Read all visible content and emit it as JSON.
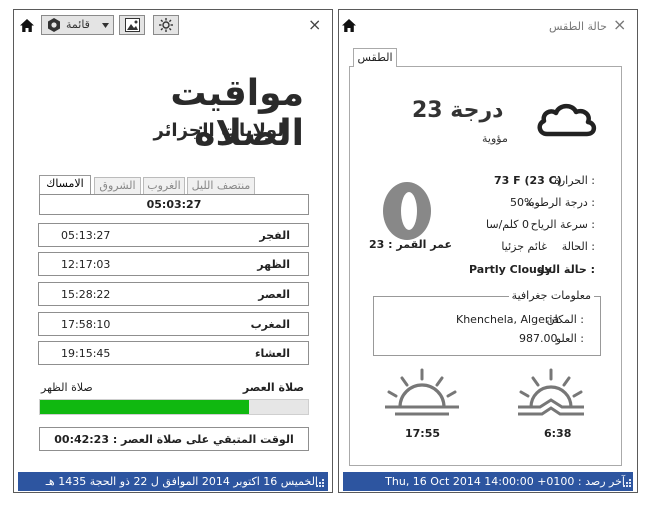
{
  "left_window": {
    "toolbar": {
      "menu_label": "قائمة",
      "home_icon": "home-icon",
      "settings_icon": "gear-icon",
      "image_icon": "image-icon",
      "brightness_icon": "sun-icon",
      "close_label": "×"
    },
    "logo_title": "مواقيت الصلاة",
    "logo_subtitle": "لولايات الجزائر",
    "tabs": [
      "الامساك",
      "الشروق",
      "الغروب",
      "منتصف الليل"
    ],
    "selected_time": "05:03:27",
    "prayers": [
      {
        "name": "الفجر",
        "time": "05:13:27"
      },
      {
        "name": "الظهر",
        "time": "12:17:03"
      },
      {
        "name": "العصر",
        "time": "15:28:22"
      },
      {
        "name": "المغرب",
        "time": "17:58:10"
      },
      {
        "name": "العشاء",
        "time": "19:15:45"
      }
    ],
    "progress": {
      "next_label": "صلاة العصر",
      "prev_label": "صلاة الظهر",
      "fraction": 0.78,
      "fill_color": "#10b810"
    },
    "remaining": "الوقت المتبقي على صلاة العصر : 00:42:23",
    "status_bar": "الخميس 16 اكتوبر 2014 الموافق ل 22 ذو الحجة 1435 هـ"
  },
  "right_window": {
    "title": "حالة الطقس",
    "close_label": "×",
    "tab_label": "الطقس",
    "temperature": "23 درجة",
    "unit_label": "مؤوية",
    "moon_age": "عمر القمر : 23",
    "details": [
      {
        "label": "الحرارة :",
        "value": "73 F (23 C)"
      },
      {
        "label": "درجة الرطوبة :",
        "value": "50%"
      },
      {
        "label": "سرعة الرياح :",
        "value": "0 كلم/سا"
      },
      {
        "label": "الحالة :",
        "value": "غائم جزئيا"
      }
    ],
    "sky_label": "حالة الجو :",
    "sky_value": "Partly Cloudy",
    "geo": {
      "legend": "معلومات جغرافية",
      "place_label": "المكان :",
      "place_value": "Khenchela, Algeria",
      "alt_label": "العلو :",
      "alt_value": "987.00"
    },
    "sunset_time": "17:55",
    "sunrise_time": "6:38",
    "status_bar": "آخر رصد : Thu, 16 Oct 2014 14:00:00 +0100"
  }
}
